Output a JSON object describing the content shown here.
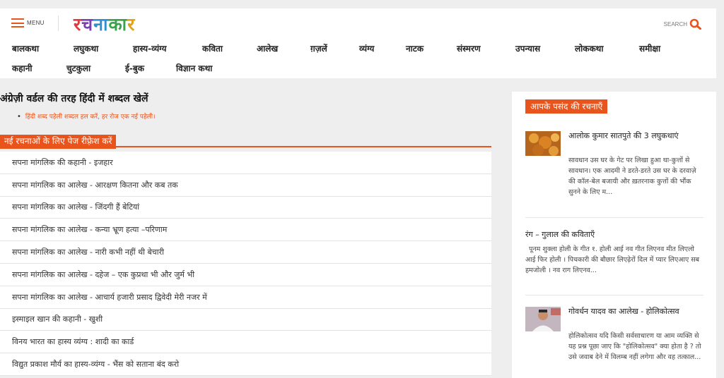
{
  "header": {
    "menu_label": "MENU",
    "logo_chars": [
      "र",
      "च",
      "ना",
      "का",
      "र"
    ],
    "search_label": "SEARCH",
    "menu_icon": "hamburger-icon",
    "search_icon": "magnifier-icon",
    "accent": "#e8541c"
  },
  "nav": {
    "row1": [
      "बालकथा",
      "लघुकथा",
      "हास्य-व्यंग्य",
      "कविता",
      "आलेख",
      "ग़ज़लें",
      "व्यंग्य",
      "नाटक",
      "संस्मरण",
      "उपन्यास",
      "लोककथा",
      "समीक्षा"
    ],
    "row2": [
      "कहानी",
      "चुटकुला",
      "ई-बुक",
      "विज्ञान कथा"
    ]
  },
  "post": {
    "title": "अंग्रेज़ी वर्डल की तरह हिंदी में शब्दल खेलें",
    "bullet": "हिंदी शब्द पहेली शब्दल हल करें, हर रोज एक नई पहेली।"
  },
  "refresh_label": "नई रचनाओं के लिए पेज रीफ़्रेश करें",
  "list": [
    "सपना मांगलिक की कहानी - इजहार",
    "सपना मांगलिक का आलेख - आरक्षण कितना और कब तक",
    "सपना मांगलिक का आलेख - जिंदगी हैं बेटियां",
    "सपना मांगलिक का आलेख - कन्या भ्रूण हत्या –परिणाम",
    "सपना मांगलिक का आलेख - नारी कभी नहीं थी बेचारी",
    "सपना मांगलिक का आलेख - दहेज – एक कुप्रथा भी और जुर्म भी",
    "सपना मांगलिक का आलेख - आचार्य हजारी प्रसाद द्विवेदी मेरी नजर में",
    "इस्माइल खान की कहानी - खुशी",
    "विनय भारत का हास्य व्यंग्य : शादी का कार्ड",
    "विद्युत प्रकाश मौर्य का हास्य-व्यंग्य - भैंस को सताना बंद करो"
  ],
  "sidebar": {
    "heading": "आपके पसंद की रचनाएँ",
    "items": [
      {
        "title": "आलोक कुमार सातपुते की 3 लघुकथाएं",
        "snippet": "सावधान उस घर के गेट पर लिखा हुआ था-कुत्तों से सावधान। एक आदमी ने डरते-डरते उस घर के दरवाज़े की कॉल-बेल बजायी और ख़तरनाक कुत्तों की भौंक सुनने के लिए म..."
      },
      {
        "title": "रंग – गुलाल की कविताएँ",
        "snippet": "पूनम शुक्ला होली के गीत १. होली आई नव गीत लिएनव मीत लिएलो आई फिर होली । पिचकारी की बौछार लिएढ़ेरों दिल में प्यार लिएआए सब हमजोली । नव राग लिएनव..."
      },
      {
        "title": "गोवर्धन यादव का आलेख - होलिकोत्सव",
        "snippet": "होलिकोत्सव यदि किसी सर्वसाधारण या आम व्यक्ति से यह प्रश्न पूछा जाए कि \"होलिकोत्सव\" क्या होता है ? तो उसे जवाब देने में विलम्ब नहीं लगेगा और वह तत्काल..."
      }
    ]
  }
}
